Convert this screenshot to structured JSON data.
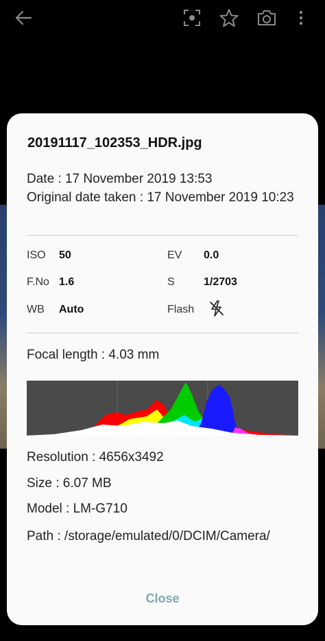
{
  "toolbar": {
    "back_icon": "back-arrow-icon",
    "icons": [
      "bixby-vision-icon",
      "favorite-star-icon",
      "camera-icon",
      "more-options-icon"
    ]
  },
  "dialog": {
    "filename": "20191117_102353_HDR.jpg",
    "date": "Date : 17 November 2019 13:53",
    "original_date": "Original date taken : 17 November 2019 10:23",
    "exif": {
      "iso_label": "ISO",
      "iso_value": "50",
      "ev_label": "EV",
      "ev_value": "0.0",
      "fno_label": "F.No",
      "fno_value": "1.6",
      "s_label": "S",
      "s_value": "1/2703",
      "wb_label": "WB",
      "wb_value": "Auto",
      "flash_label": "Flash",
      "flash_icon": "flash-off-icon"
    },
    "focal_length": "Focal length : 4.03 mm",
    "resolution": "Resolution : 4656x3492",
    "size": "Size : 6.07 MB",
    "model": "Model : LM-G710",
    "path": "Path : /storage/emulated/0/DCIM/Camera/",
    "close_label": "Close"
  },
  "colors": {
    "dialog_bg": "#fafafa",
    "close_text": "#7fa8ae",
    "histogram_bg": "#4a4a4a"
  }
}
